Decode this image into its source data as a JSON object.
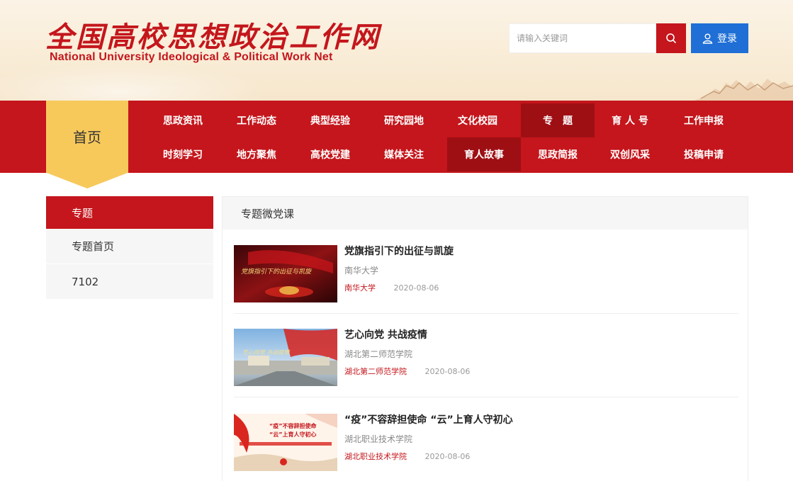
{
  "site": {
    "title_cn": "全国高校思想政治工作网",
    "title_en": "National University Ideological & Political Work Net"
  },
  "search": {
    "placeholder": "请输入关键词",
    "icon": "search-icon"
  },
  "login": {
    "label": "登录",
    "icon": "user-icon"
  },
  "nav": {
    "home": "首页",
    "row1": [
      "思政资讯",
      "工作动态",
      "典型经验",
      "研究园地",
      "文化校园",
      "专　题",
      "育 人 号",
      "工作申报"
    ],
    "row2": [
      "时刻学习",
      "地方聚焦",
      "高校党建",
      "媒体关注",
      "育人故事",
      "思政简报",
      "双创风采",
      "投稿申请"
    ],
    "active_row1": "专　题",
    "active_row2": "育人故事"
  },
  "sidebar": {
    "header": "专题",
    "items": [
      "专题首页",
      "7102"
    ]
  },
  "panel": {
    "header": "专题微党课",
    "articles": [
      {
        "title": "党旗指引下的出征与凯旋",
        "subtitle": "南华大学",
        "source": "南华大学",
        "date": "2020-08-06"
      },
      {
        "title": "艺心向党 共战疫情",
        "subtitle": "湖北第二师范学院",
        "source": "湖北第二师范学院",
        "date": "2020-08-06"
      },
      {
        "title": "“疫”不容辞担使命 “云”上育人守初心",
        "subtitle": "湖北职业技术学院",
        "source": "湖北职业技术学院",
        "date": "2020-08-06"
      }
    ]
  },
  "colors": {
    "brand_red": "#c4161c",
    "active_red": "#9e0f14",
    "home_yellow": "#f7c95b",
    "login_blue": "#1f6fd6"
  }
}
